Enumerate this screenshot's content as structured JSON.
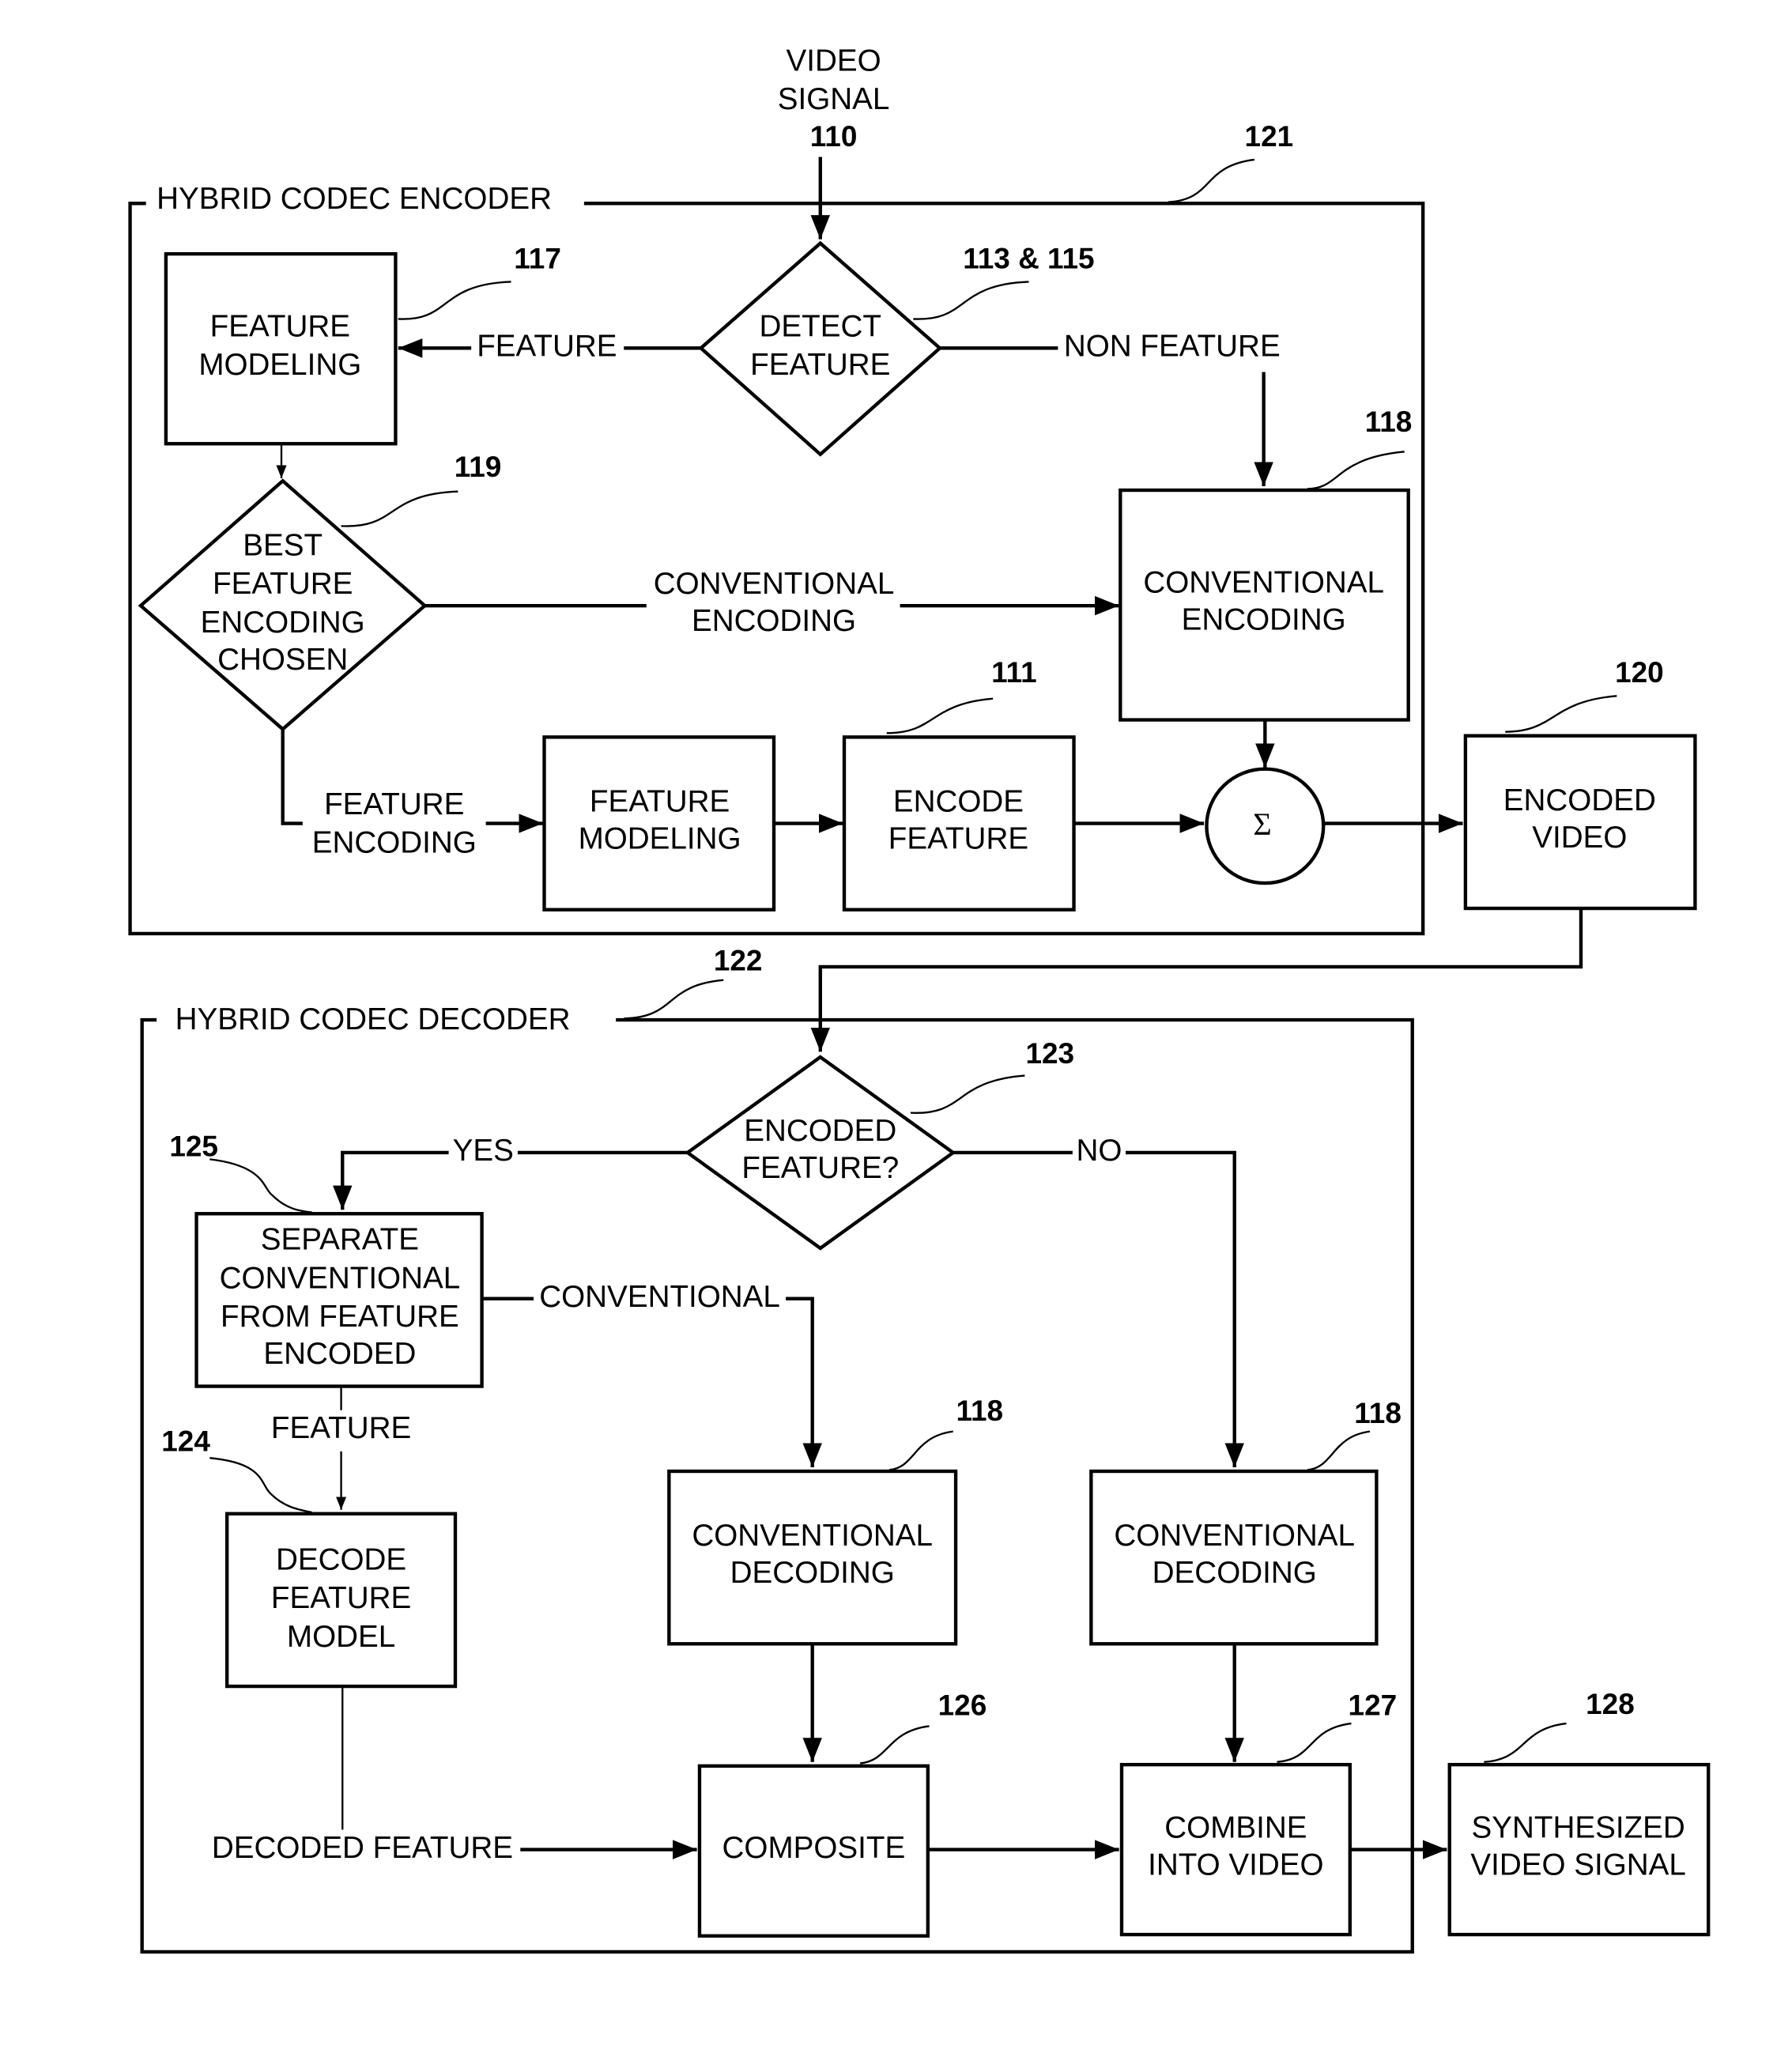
{
  "input": {
    "label_1": "VIDEO",
    "label_2": "SIGNAL",
    "ref": "110"
  },
  "encoder": {
    "title": "HYBRID CODEC ENCODER",
    "ref": "121",
    "detect_feature": {
      "line1": "DETECT",
      "line2": "FEATURE",
      "ref": "113 & 115"
    },
    "feature_modeling_top": {
      "line1": "FEATURE",
      "line2": "MODELING",
      "ref": "117"
    },
    "best_feature": {
      "line1": "BEST",
      "line2": "FEATURE",
      "line3": "ENCODING",
      "line4": "CHOSEN",
      "ref": "119"
    },
    "conventional_encoding": {
      "line1": "CONVENTIONAL",
      "line2": "ENCODING",
      "ref": "118"
    },
    "feature_modeling_bottom": {
      "line1": "FEATURE",
      "line2": "MODELING"
    },
    "encode_feature": {
      "line1": "ENCODE",
      "line2": "FEATURE",
      "ref": "111"
    },
    "sum_symbol": "Σ",
    "edge_labels": {
      "feature": "FEATURE",
      "non_feature": "NON FEATURE",
      "conventional_1": "CONVENTIONAL",
      "conventional_2": "ENCODING",
      "feature_enc_1": "FEATURE",
      "feature_enc_2": "ENCODING"
    }
  },
  "encoded_video": {
    "line1": "ENCODED",
    "line2": "VIDEO",
    "ref": "120"
  },
  "decoder": {
    "title": "HYBRID CODEC DECODER",
    "ref": "122",
    "encoded_feature": {
      "line1": "ENCODED",
      "line2": "FEATURE?",
      "ref": "123"
    },
    "separate": {
      "line1": "SEPARATE",
      "line2": "CONVENTIONAL",
      "line3": "FROM FEATURE",
      "line4": "ENCODED",
      "ref": "125"
    },
    "decode_feature_model": {
      "line1": "DECODE",
      "line2": "FEATURE",
      "line3": "MODEL",
      "ref": "124"
    },
    "conv_decoding_a": {
      "line1": "CONVENTIONAL",
      "line2": "DECODING",
      "ref": "118"
    },
    "conv_decoding_b": {
      "line1": "CONVENTIONAL",
      "line2": "DECODING",
      "ref": "118"
    },
    "composite": {
      "line1": "COMPOSITE",
      "ref": "126"
    },
    "combine": {
      "line1": "COMBINE",
      "line2": "INTO VIDEO",
      "ref": "127"
    },
    "edge_labels": {
      "yes": "YES",
      "no": "NO",
      "conventional": "CONVENTIONAL",
      "feature": "FEATURE",
      "decoded_feature": "DECODED FEATURE"
    }
  },
  "output": {
    "line1": "SYNTHESIZED",
    "line2": "VIDEO SIGNAL",
    "ref": "128"
  }
}
